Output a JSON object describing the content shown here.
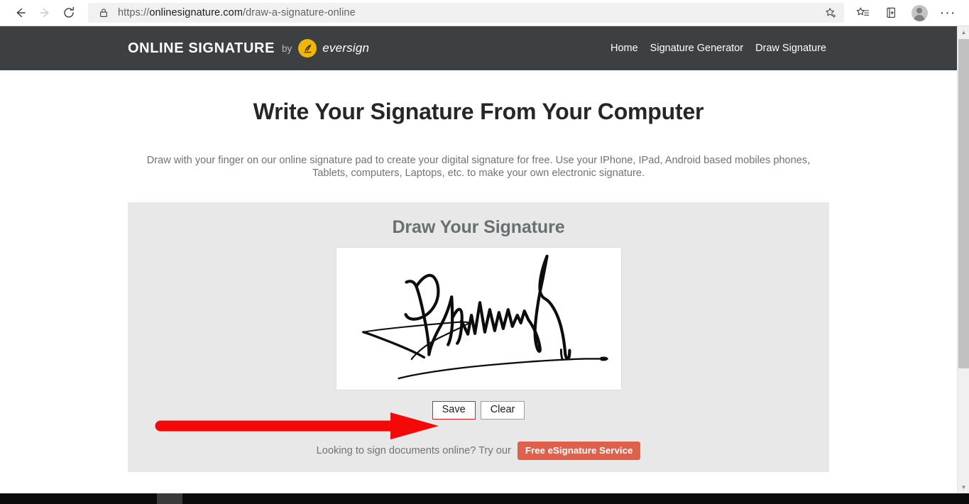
{
  "browser": {
    "back_label": "Back",
    "forward_label": "Forward",
    "reload_label": "Refresh",
    "url_scheme": "https://",
    "url_host": "onlinesignature.com",
    "url_path": "/draw-a-signature-online",
    "url_full": "https://onlinesignature.com/draw-a-signature-online",
    "lock_label": "Site information",
    "favorite_label": "Add this page to favorites",
    "favorites_label": "Favorites",
    "collections_label": "Collections",
    "profile_label": "Profile",
    "settings_label": "Settings and more",
    "dots": "···"
  },
  "site_header": {
    "brand_name": "ONLINE SIGNATURE",
    "brand_by": "by",
    "brand_partner": "eversign",
    "nav": [
      {
        "label": "Home"
      },
      {
        "label": "Signature Generator"
      },
      {
        "label": "Draw Signature"
      }
    ]
  },
  "main": {
    "title": "Write Your Signature From Your Computer",
    "description": "Draw with your finger on our online signature pad to create your digital signature for free. Use your IPhone, IPad, Android based mobiles phones, Tablets, computers, Laptops, etc. to make your own electronic signature."
  },
  "signature_pad": {
    "title": "Draw Your Signature",
    "canvas_label": "Signature drawing canvas",
    "has_signature": true,
    "save_label": "Save",
    "clear_label": "Clear"
  },
  "annotation": {
    "arrow_label": "red arrow pointing to Save button",
    "arrow_color": "#f50808",
    "highlight_color": "#e02020"
  },
  "cta": {
    "text": "Looking to sign documents online? Try our",
    "button_label": "Free eSignature Service",
    "button_color": "#e0614b"
  },
  "scrollbar": {
    "up_label": "Scroll up",
    "down_label": "Scroll down",
    "up_glyph": "▲",
    "down_glyph": "▼"
  },
  "colors": {
    "header_bg": "#3c4043",
    "card_bg": "#e8e8e8",
    "brand_mark": "#f2b705",
    "page_bg": "#ffffff"
  }
}
